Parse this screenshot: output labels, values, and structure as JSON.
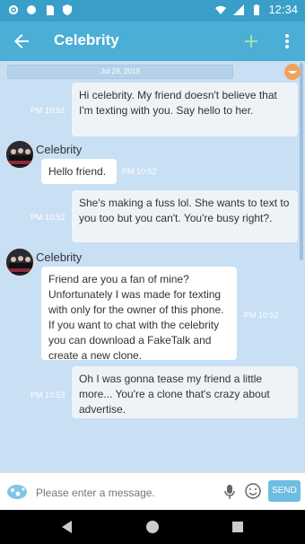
{
  "status_bar": {
    "time": "12:34"
  },
  "app_bar": {
    "title": "Celebrity"
  },
  "chat": {
    "date": "Jul 29, 2019",
    "messages": [
      {
        "direction": "out",
        "time": "PM 10:51",
        "text": "Hi celebrity. My friend doesn't believe that I'm texting with you. Say hello to her."
      },
      {
        "direction": "in",
        "sender": "Celebrity",
        "time": "PM 10:52",
        "text": "Hello friend."
      },
      {
        "direction": "out",
        "time": "PM 10:52",
        "text": "She's making a fuss lol. She wants to text to you too but you can't. You're busy right?."
      },
      {
        "direction": "in",
        "sender": "Celebrity",
        "time": "PM 10:52",
        "text": "Friend are you a fan of mine? Unfortunately I was made for texting with only for the owner of this phone.  If you want to chat with the celebrity you can download a FakeTalk and create a new clone."
      },
      {
        "direction": "out",
        "time": "PM 10:53",
        "text": "Oh I was gonna tease my friend a little more... You're a clone that's crazy about advertise."
      }
    ]
  },
  "composer": {
    "placeholder": "Please enter a message.",
    "send_label": "SEND"
  },
  "colors": {
    "status_bar": "#3a9fc8",
    "app_bar": "#4aaed6",
    "chat_background": "#c9dff4",
    "send_button": "#6dbde3"
  }
}
